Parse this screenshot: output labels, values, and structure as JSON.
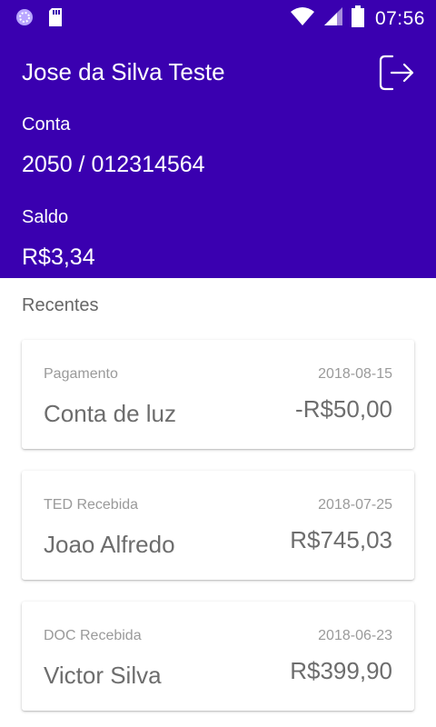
{
  "status_bar": {
    "time": "07:56",
    "icons": [
      "app-notification-icon",
      "sd-card-icon",
      "wifi-icon",
      "signal-icon",
      "battery-icon"
    ]
  },
  "header": {
    "user_name": "Jose da Silva Teste",
    "logout_icon": "logout-icon",
    "account_label": "Conta",
    "account_value": "2050 / 012314564",
    "balance_label": "Saldo",
    "balance_value": "R$3,34"
  },
  "recent": {
    "title": "Recentes",
    "transactions": [
      {
        "type": "Pagamento",
        "date": "2018-08-15",
        "description": "Conta de luz",
        "amount": "-R$50,00"
      },
      {
        "type": "TED Recebida",
        "date": "2018-07-25",
        "description": "Joao Alfredo",
        "amount": "R$745,03"
      },
      {
        "type": "DOC Recebida",
        "date": "2018-06-23",
        "description": "Victor Silva",
        "amount": "R$399,90"
      }
    ]
  },
  "colors": {
    "primary": "#3a00b0",
    "text_secondary": "#9a9a9a",
    "text_primary": "#6d6d6d"
  }
}
